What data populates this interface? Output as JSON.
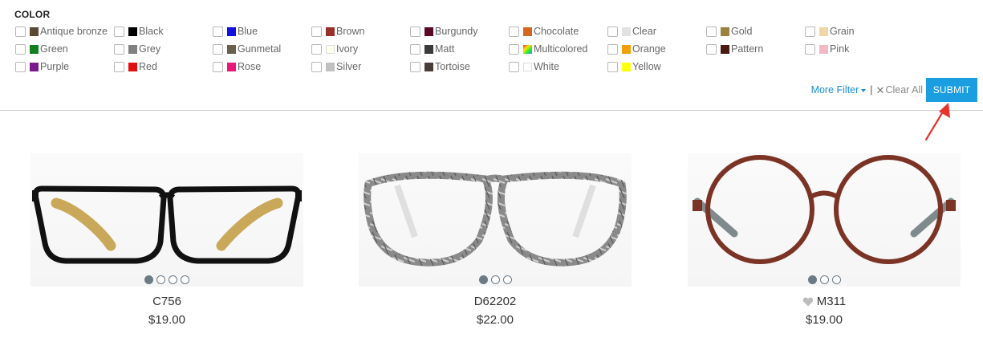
{
  "filter": {
    "title": "COLOR",
    "colors": [
      {
        "label": "Antique bronze",
        "swatch": "#5a4a32"
      },
      {
        "label": "Black",
        "swatch": "#000000"
      },
      {
        "label": "Blue",
        "swatch": "#1010e0"
      },
      {
        "label": "Brown",
        "swatch": "#9a2e2a"
      },
      {
        "label": "Burgundy",
        "swatch": "#5a0a22"
      },
      {
        "label": "Chocolate",
        "swatch": "#d2691e"
      },
      {
        "label": "Clear",
        "swatch": "#e2e2e2"
      },
      {
        "label": "Gold",
        "swatch": "#9b8140"
      },
      {
        "label": "Grain",
        "swatch": "#f1d6a8"
      },
      {
        "label": "Green",
        "swatch": "#0f7f1f"
      },
      {
        "label": "Grey",
        "swatch": "#808080"
      },
      {
        "label": "Gunmetal",
        "swatch": "#6a5e4c"
      },
      {
        "label": "Ivory",
        "swatch": "#fffff0"
      },
      {
        "label": "Matt",
        "swatch": "#3a3a3a"
      },
      {
        "label": "Multicolored",
        "swatch": "multicolor"
      },
      {
        "label": "Orange",
        "swatch": "#f0a000"
      },
      {
        "label": "Pattern",
        "swatch": "#4a1a12"
      },
      {
        "label": "Pink",
        "swatch": "#f5b9c6"
      },
      {
        "label": "Purple",
        "swatch": "#7a1a8a"
      },
      {
        "label": "Red",
        "swatch": "#e01010"
      },
      {
        "label": "Rose",
        "swatch": "#e8197a"
      },
      {
        "label": "Silver",
        "swatch": "#c0c0c0"
      },
      {
        "label": "Tortoise",
        "swatch": "#4a3c38"
      },
      {
        "label": "White",
        "swatch": "#ffffff"
      },
      {
        "label": "Yellow",
        "swatch": "#ffff10"
      }
    ],
    "more_filter_label": "More Filter",
    "separator": "|",
    "clear_all_label": "Clear All",
    "submit_label": "SUBMIT"
  },
  "products": [
    {
      "name": "C756",
      "price": "$19.00",
      "image_dots": 4,
      "active_dot": 0,
      "has_heart": false
    },
    {
      "name": "D62202",
      "price": "$22.00",
      "image_dots": 3,
      "active_dot": 0,
      "has_heart": false
    },
    {
      "name": "M311",
      "price": "$19.00",
      "image_dots": 3,
      "active_dot": 0,
      "has_heart": true
    }
  ],
  "colors": {
    "accent": "#1a9ee0",
    "link": "#1a8fd6",
    "annotation_arrow": "#e8332d"
  }
}
